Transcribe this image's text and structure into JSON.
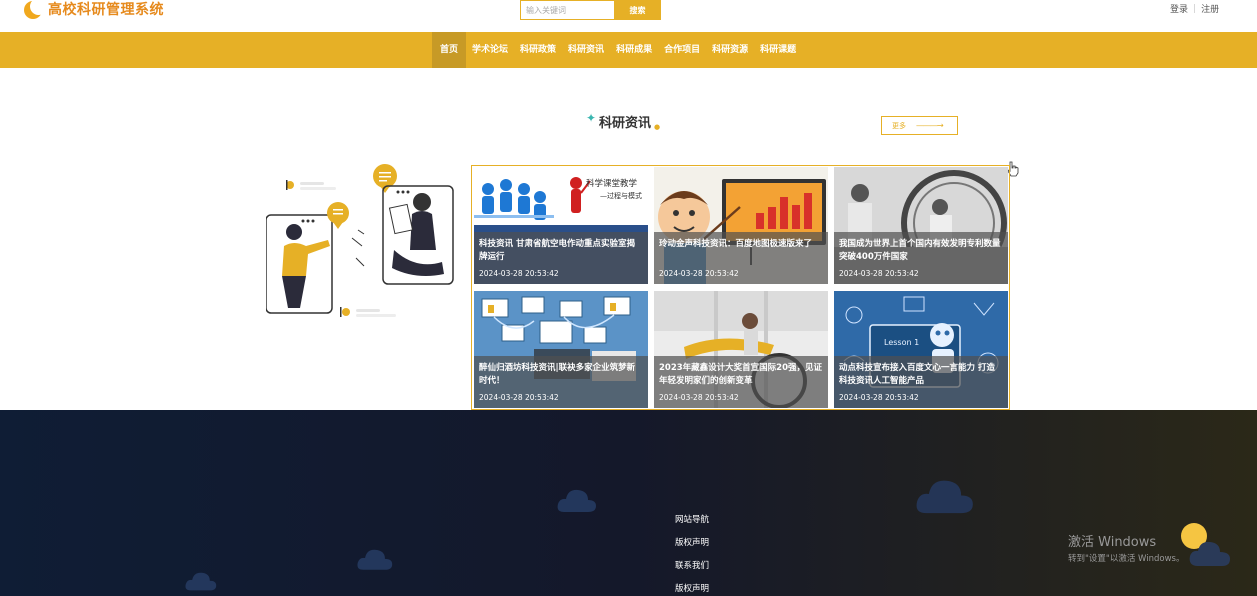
{
  "header": {
    "logo_text": "高校科研管理系统",
    "search_placeholder": "输入关键词",
    "search_button": "搜索",
    "login": "登录",
    "register": "注册"
  },
  "nav": {
    "items": [
      "首页",
      "学术论坛",
      "科研政策",
      "科研资讯",
      "科研成果",
      "合作项目",
      "科研资源",
      "科研课题"
    ],
    "active_index": 0
  },
  "section": {
    "title": "科研资讯",
    "more": "更多"
  },
  "news": [
    {
      "title": "科技资讯 甘肃省航空电作动重点实验室揭牌运行",
      "date": "2024-03-28 20:53:42",
      "image_text": "科学课堂教学",
      "image_sub": "—过程与模式"
    },
    {
      "title": "玲动金声科技资讯：百度地图极速版来了",
      "date": "2024-03-28 20:53:42"
    },
    {
      "title": "我国成为世界上首个国内有效发明专利数量突破400万件国家",
      "date": "2024-03-28 20:53:42"
    },
    {
      "title": "醉仙归酒坊科技资讯|联袂多家企业筑梦新时代！",
      "date": "2024-03-28 20:53:42"
    },
    {
      "title": "2023年藏鑫设计大奖首宣国际20强，见证年轻发明家们的创新变革",
      "date": "2024-03-28 20:53:42"
    },
    {
      "title": "动点科技宣布接入百度文心一言能力 打造科技资讯人工智能产品",
      "date": "2024-03-28 20:53:42",
      "image_text": "Lesson 1"
    }
  ],
  "footer": {
    "links": [
      "网站导航",
      "版权声明",
      "联系我们",
      "版权声明"
    ],
    "activate_title": "激活 Windows",
    "activate_sub": "转到\"设置\"以激活 Windows。"
  },
  "colors": {
    "accent": "#e6b026",
    "nav_active": "#c79a26",
    "footer_bg": "#0f1d35"
  }
}
